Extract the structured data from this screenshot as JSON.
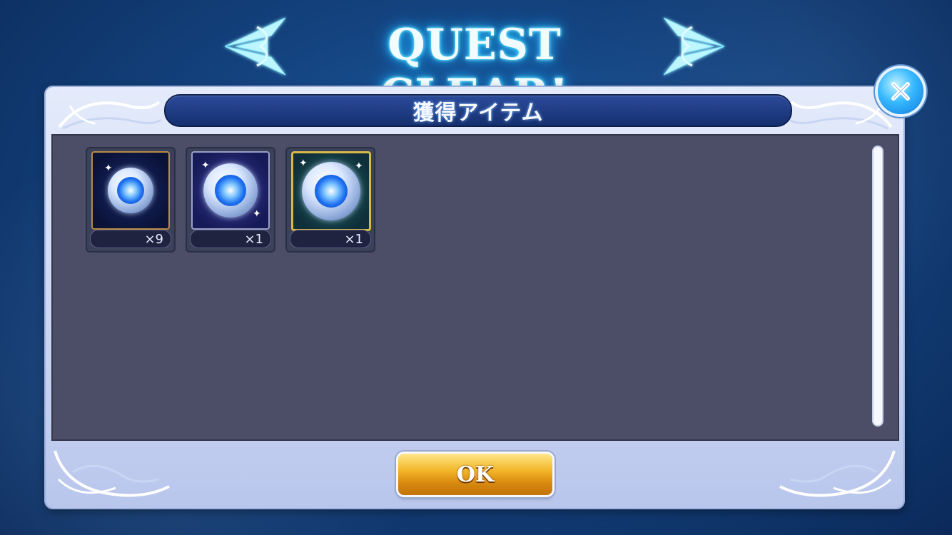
{
  "title": "QUEST CLEAR!",
  "dialog": {
    "header": "獲得アイテム",
    "ok_label": "OK"
  },
  "items": [
    {
      "count": "×9",
      "icon": "crystal-orb-icon",
      "rarity": "common"
    },
    {
      "count": "×1",
      "icon": "crystal-orb-icon",
      "rarity": "rare"
    },
    {
      "count": "×1",
      "icon": "crystal-orb-icon",
      "rarity": "epic"
    }
  ],
  "colors": {
    "title_glow": "#26c3ff",
    "panel_bg": "#4c4e68",
    "header_bg": "#15306f",
    "ok_button": "#f3b72a",
    "close_button": "#36b8ff"
  }
}
